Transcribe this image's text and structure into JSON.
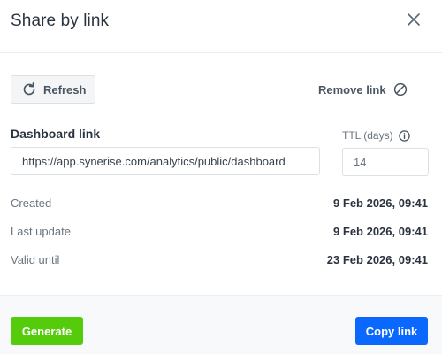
{
  "modal": {
    "title": "Share by link"
  },
  "actions": {
    "refresh_label": "Refresh",
    "remove_link_label": "Remove link"
  },
  "form": {
    "dashboard_link_label": "Dashboard link",
    "dashboard_link_value": "https://app.synerise.com/analytics/public/dashboard",
    "ttl_label": "TTL (days)",
    "ttl_value": "14"
  },
  "info": {
    "created_label": "Created",
    "created_value": "9 Feb 2026, 09:41",
    "last_update_label": "Last update",
    "last_update_value": "9 Feb 2026, 09:41",
    "valid_until_label": "Valid until",
    "valid_until_value": "23 Feb 2026, 09:41"
  },
  "footer": {
    "generate_label": "Generate",
    "copy_link_label": "Copy link"
  },
  "colors": {
    "generate": "#54cb0b",
    "copy_link": "#0b68ff"
  },
  "icons": {
    "close": "close-icon",
    "refresh": "refresh-icon",
    "remove_link": "block-icon",
    "ttl_info": "info-icon"
  }
}
